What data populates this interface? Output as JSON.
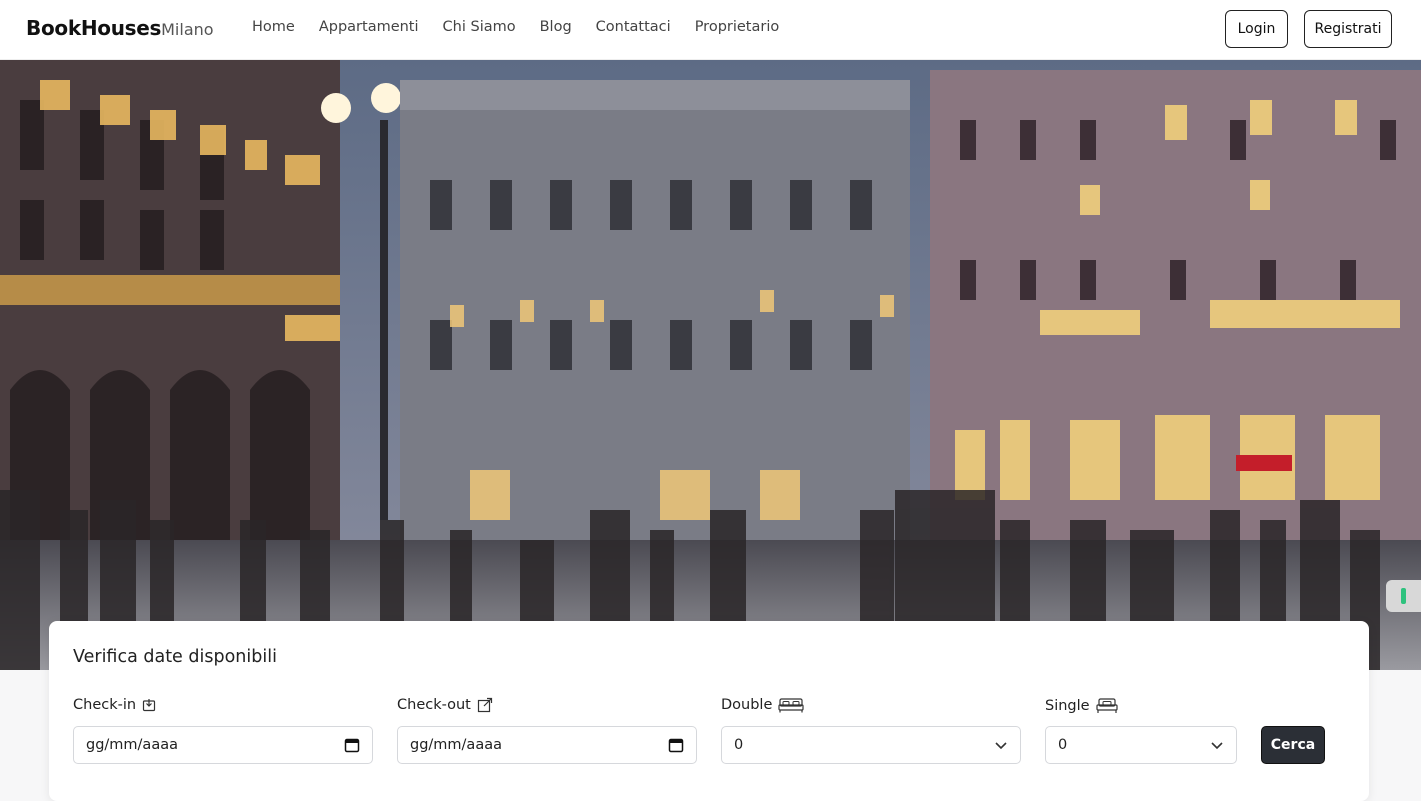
{
  "brand": {
    "main": "BookHouses",
    "sub": "Milano"
  },
  "nav": {
    "links": [
      "Home",
      "Appartamenti",
      "Chi Siamo",
      "Blog",
      "Contattaci",
      "Proprietario"
    ],
    "login": "Login",
    "register": "Registrati"
  },
  "search": {
    "title": "Verifica date disponibili",
    "checkin_label": "Check-in",
    "checkin_value": "gg/mm/aaaa",
    "checkout_label": "Check-out",
    "checkout_value": "gg/mm/aaaa",
    "double_label": "Double",
    "double_value": "0",
    "single_label": "Single",
    "single_value": "0",
    "submit": "Cerca"
  },
  "icons": {
    "checkin": "calendar-download-icon",
    "checkout": "external-link-icon",
    "double": "double-bed-icon",
    "single": "single-bed-icon",
    "date_picker": "calendar-icon",
    "select": "chevron-down-icon"
  }
}
